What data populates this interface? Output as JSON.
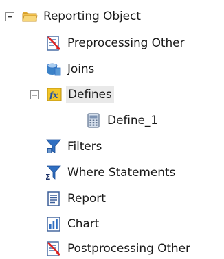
{
  "tree": {
    "root": {
      "label": "Reporting Object",
      "toggle": "collapse",
      "icon": "folder-open-icon"
    },
    "items": [
      {
        "label": "Preprocessing Other",
        "icon": "preprocessing-icon"
      },
      {
        "label": "Joins",
        "icon": "joins-icon"
      },
      {
        "label": "Defines",
        "icon": "defines-fx-icon",
        "toggle": "collapse",
        "selected": true
      },
      {
        "label": "Define_1",
        "icon": "calculator-icon"
      },
      {
        "label": "Filters",
        "icon": "filter-icon"
      },
      {
        "label": "Where Statements",
        "icon": "where-filter-icon"
      },
      {
        "label": "Report",
        "icon": "report-document-icon"
      },
      {
        "label": "Chart",
        "icon": "bar-chart-icon"
      },
      {
        "label": "Postprocessing Other",
        "icon": "postprocessing-icon"
      }
    ]
  },
  "colors": {
    "folder": "#f2c14e",
    "filter_blue": "#2f6fc2",
    "selection_bg": "#e9e9e9"
  }
}
